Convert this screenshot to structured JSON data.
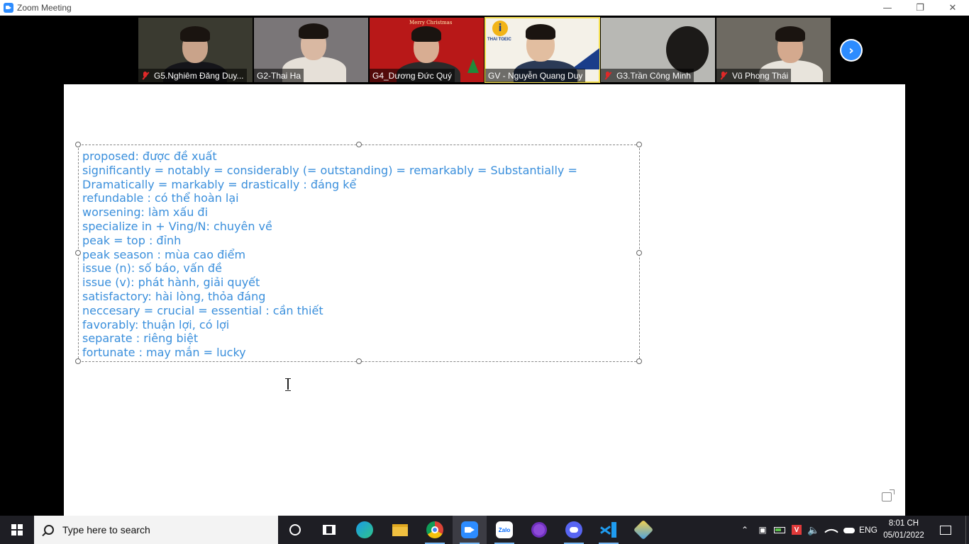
{
  "window": {
    "title": "Zoom Meeting"
  },
  "participants": [
    {
      "name": "G5.Nghiêm Đăng Duy...",
      "muted": true,
      "bg": "#3a3a30"
    },
    {
      "name": "G2-Thai Ha",
      "muted": false,
      "bg": "#7a7678"
    },
    {
      "name": "G4_Dương Đức Quý",
      "muted": false,
      "bg": "#b81818"
    },
    {
      "name": "GV - Nguyễn Quang Duy",
      "muted": false,
      "active": true,
      "bg": "#f4f1e8"
    },
    {
      "name": "G3.Trần Công Minh",
      "muted": true,
      "bg": "#b8b8b4"
    },
    {
      "name": "Vũ Phong Thái",
      "muted": true,
      "bg": "#6e6a62"
    }
  ],
  "tile_overlays": {
    "christmas": "Merry Christmas",
    "logo": "THAI TOEIC"
  },
  "whiteboard": {
    "lines": [
      "proposed: được đề xuất",
      "significantly = notably = considerably (= outstanding) = remarkably = Substantially =",
      "Dramatically = markably = drastically : đáng kể",
      "refundable : có thể hoàn lại",
      "worsening: làm xấu đi",
      "specialize in + Ving/N: chuyên về",
      "peak = top : đỉnh",
      "peak season : mùa cao điểm",
      "issue (n): số báo, vấn đề",
      "issue (v): phát hành, giải quyết",
      "satisfactory: hài lòng, thỏa đáng",
      "neccesary = crucial = essential : cần thiết",
      "favorably: thuận lợi, có lợi",
      "separate : riêng biệt",
      "fortunate : may mắn = lucky"
    ],
    "text_color": "#3a8fdc"
  },
  "taskbar": {
    "search_placeholder": "Type here to search",
    "apps": [
      "cortana-icon",
      "task-view-icon",
      "edge-icon",
      "file-explorer-icon",
      "chrome-icon",
      "zoom-icon",
      "zalo-icon",
      "github-desktop-icon",
      "discord-icon",
      "vscode-icon",
      "app-cube-icon"
    ],
    "zalo_label": "Zalo",
    "language": "ENG",
    "time": "8:01 CH",
    "date": "05/01/2022"
  },
  "colors": {
    "zoom_blue": "#2D8CFF",
    "active_speaker": "#f5e050",
    "mute_red": "#e02828"
  }
}
